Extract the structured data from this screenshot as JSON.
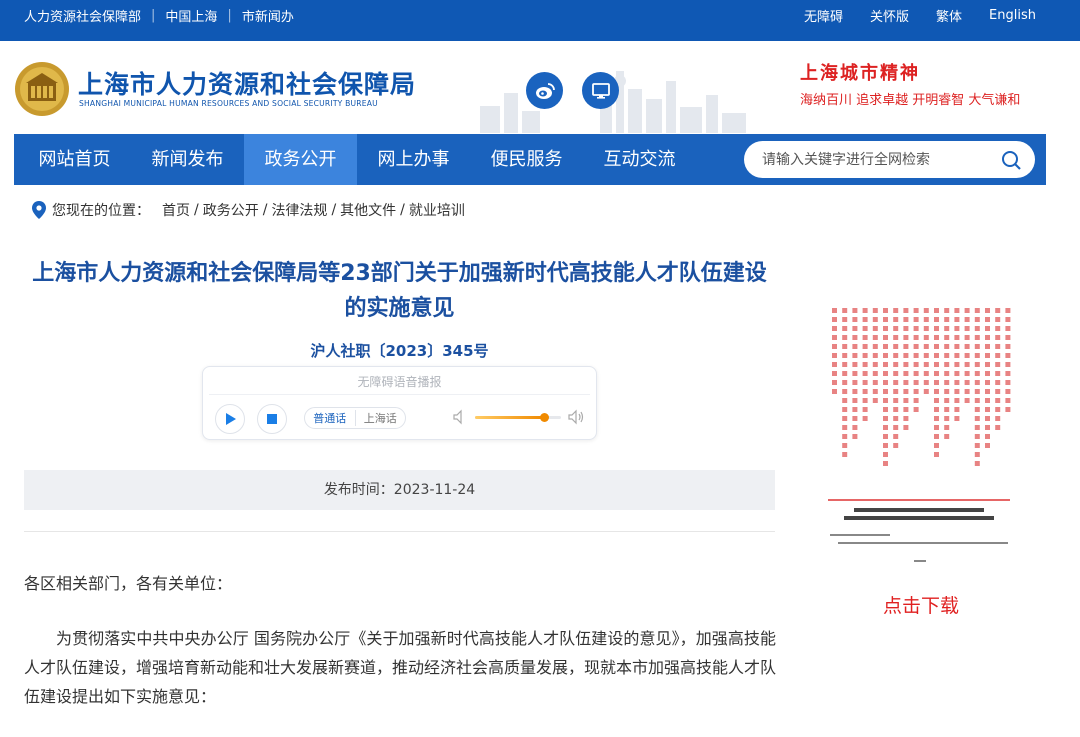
{
  "topbar": {
    "left_links": [
      "人力资源社会保障部",
      "中国上海",
      "市新闻办"
    ],
    "right_links": [
      "无障碍",
      "关怀版",
      "繁体",
      "English"
    ]
  },
  "header": {
    "title": "上海市人力资源和社会保障局",
    "subtitle": "SHANGHAI MUNICIPAL HUMAN RESOURCES AND SOCIAL SECURITY BUREAU",
    "slogan_title": "上海城市精神",
    "slogan_text": "海纳百川  追求卓越  开明睿智  大气谦和",
    "icons": [
      "weibo-icon",
      "monitor-icon"
    ]
  },
  "nav": {
    "items": [
      {
        "label": "网站首页",
        "active": false
      },
      {
        "label": "新闻发布",
        "active": false
      },
      {
        "label": "政务公开",
        "active": true
      },
      {
        "label": "网上办事",
        "active": false
      },
      {
        "label": "便民服务",
        "active": false
      },
      {
        "label": "互动交流",
        "active": false
      }
    ],
    "search_placeholder": "请输入关键字进行全网检索"
  },
  "breadcrumb": {
    "prefix": "您现在的位置：",
    "items": [
      "首页",
      "政务公开",
      "法律法规",
      "其他文件",
      "就业培训"
    ]
  },
  "article": {
    "title": "上海市人力资源和社会保障局等23部门关于加强新时代高技能人才队伍建设的实施意见",
    "doc_number": "沪人社职〔2023〕345号",
    "player": {
      "title": "无障碍语音播报",
      "lang_on": "普通话",
      "lang_off": "上海话",
      "volume": 0.8
    },
    "publish": "发布时间：2023-11-24",
    "salutation": "各区相关部门，各有关单位：",
    "paragraph": "为贯彻落实中共中央办公厅 国务院办公厅《关于加强新时代高技能人才队伍建设的意见》，加强高技能人才队伍建设，增强培育新动能和壮大发展新赛道，推动经济社会高质量发展，现就本市加强高技能人才队伍建设提出如下实施意见："
  },
  "sidebar": {
    "thumb_docno": "沪人社职〔2023〕345号",
    "thumb_title": "上海市人力资源和社会保障局等23部门关于加强新时代高技能人才队伍建设的实施意见",
    "download": "点击下载"
  },
  "colors": {
    "primary": "#1a62bd",
    "topbar": "#0f58b4",
    "active_nav": "#3c84dd",
    "title": "#1b50a0",
    "accent_red": "#e02020"
  }
}
